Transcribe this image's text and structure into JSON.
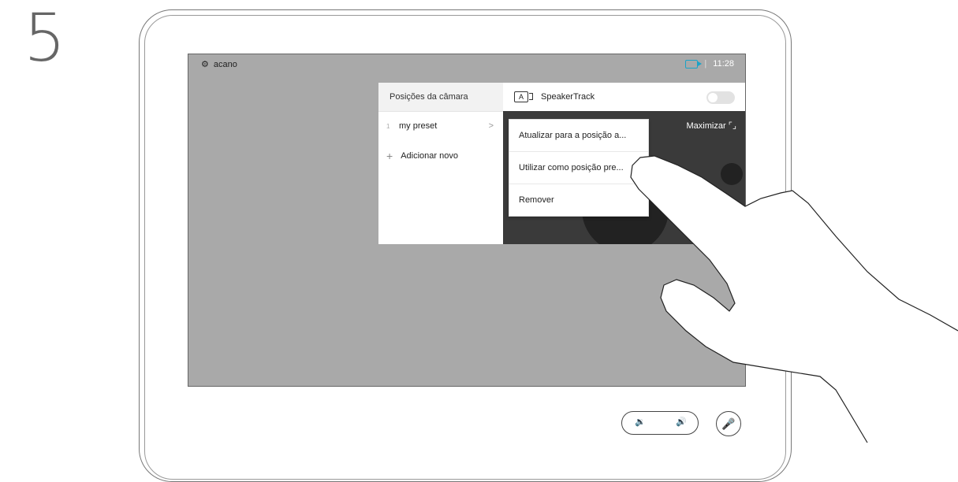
{
  "step_number": "5",
  "topbar": {
    "system_name": "acano",
    "time": "11:28",
    "separator": "|"
  },
  "camera_panel": {
    "title": "Posições da câmara",
    "presets": [
      {
        "number": "1",
        "name": "my preset"
      }
    ],
    "add_label": "Adicionar novo"
  },
  "speakertrack": {
    "label": "SpeakerTrack",
    "icon_text": "A",
    "enabled": false
  },
  "video": {
    "maximize_label": "Maximizar"
  },
  "context_menu": {
    "items": [
      "Atualizar para a posição a...",
      "Utilizar como posição pre...",
      "Remover"
    ]
  },
  "controls": {
    "volume_down": "🔉",
    "volume_up": "🔊",
    "mute": "🎤"
  },
  "colors": {
    "screen_bg": "#a9a9a9",
    "accent": "#1aa3c8"
  }
}
